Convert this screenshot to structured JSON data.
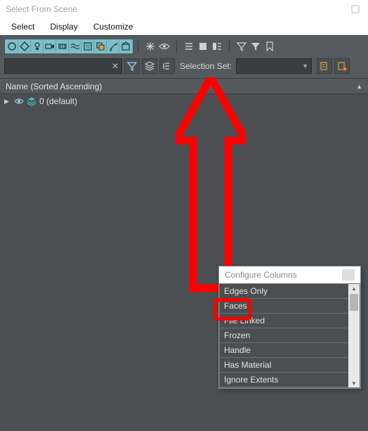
{
  "window": {
    "title": "Select From Scene"
  },
  "menu": {
    "items": [
      "Select",
      "Display",
      "Customize"
    ]
  },
  "toolbar": {
    "selection_set_label": "Selection Set:",
    "selection_set_value": ""
  },
  "name_field": {
    "value": "",
    "clear": "✕"
  },
  "column_header": {
    "label": "Name (Sorted Ascending)"
  },
  "tree": {
    "rows": [
      {
        "label": "0 (default)"
      }
    ]
  },
  "configure_popup": {
    "title": "Configure Columns",
    "items": [
      "Edges Only",
      "Faces",
      "File Linked",
      "Frozen",
      "Handle",
      "Has Material",
      "Ignore Extents"
    ]
  }
}
